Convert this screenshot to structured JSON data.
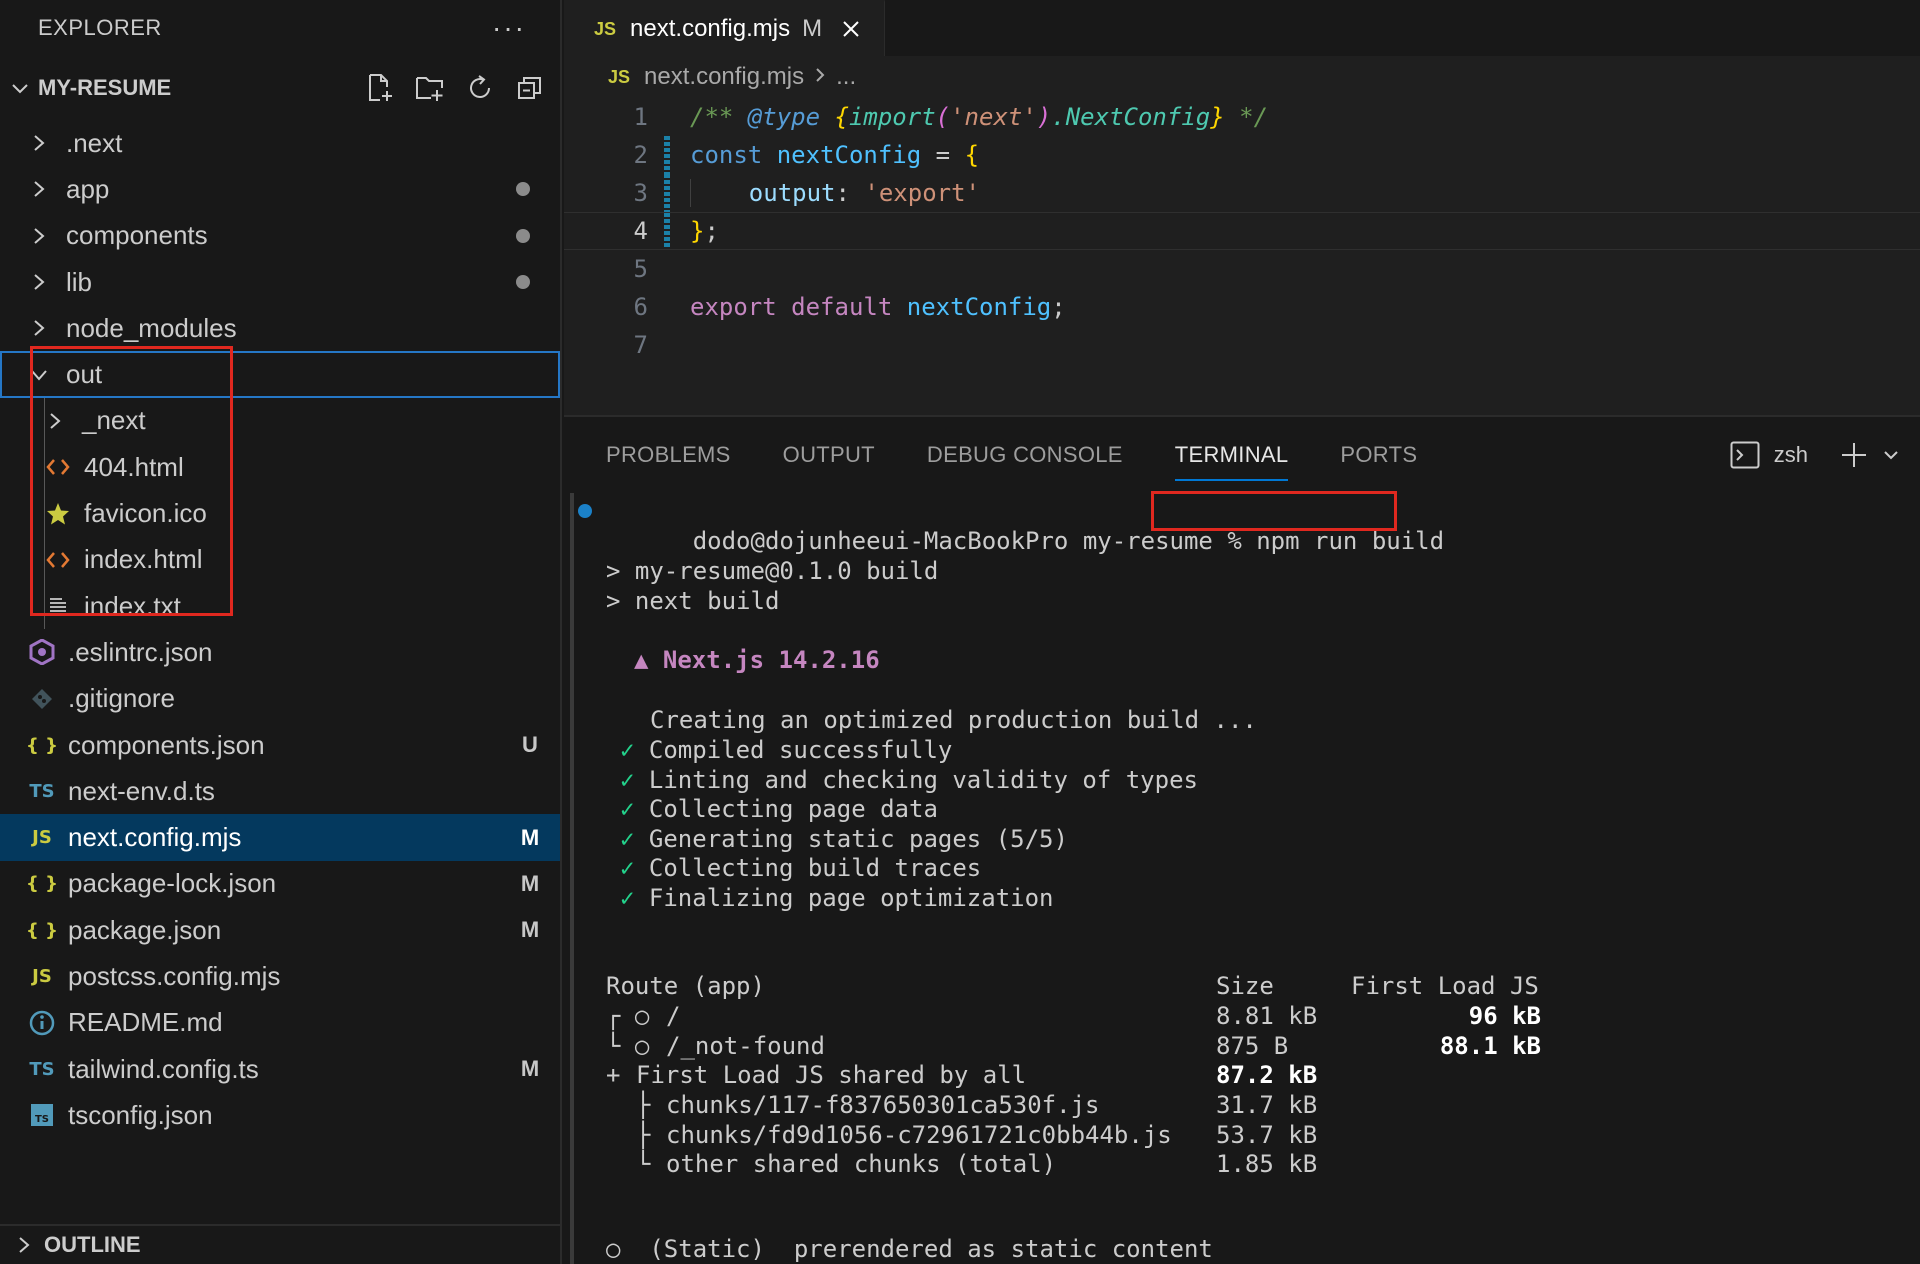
{
  "explorer": {
    "title": "EXPLORER",
    "more": "···",
    "project": "MY-RESUME",
    "outline": "OUTLINE",
    "tree": [
      {
        "label": ".next",
        "type": "folder",
        "status": ""
      },
      {
        "label": "app",
        "type": "folder",
        "status": "dot"
      },
      {
        "label": "components",
        "type": "folder",
        "status": "dot"
      },
      {
        "label": "lib",
        "type": "folder",
        "status": "dot"
      },
      {
        "label": "node_modules",
        "type": "folder",
        "status": ""
      },
      {
        "label": "out",
        "type": "folder-open",
        "status": ""
      },
      {
        "label": "_next",
        "type": "folder",
        "status": ""
      },
      {
        "label": "404.html",
        "type": "html",
        "status": ""
      },
      {
        "label": "favicon.ico",
        "type": "ico",
        "status": ""
      },
      {
        "label": "index.html",
        "type": "html",
        "status": ""
      },
      {
        "label": "index.txt",
        "type": "txt",
        "status": ""
      },
      {
        "label": ".eslintrc.json",
        "type": "eslint",
        "status": ""
      },
      {
        "label": ".gitignore",
        "type": "git",
        "status": ""
      },
      {
        "label": "components.json",
        "type": "json",
        "status": "U"
      },
      {
        "label": "next-env.d.ts",
        "type": "ts",
        "status": ""
      },
      {
        "label": "next.config.mjs",
        "type": "js",
        "status": "M"
      },
      {
        "label": "package-lock.json",
        "type": "json",
        "status": "M"
      },
      {
        "label": "package.json",
        "type": "json",
        "status": "M"
      },
      {
        "label": "postcss.config.mjs",
        "type": "js",
        "status": ""
      },
      {
        "label": "README.md",
        "type": "info",
        "status": ""
      },
      {
        "label": "tailwind.config.ts",
        "type": "ts",
        "status": "M"
      },
      {
        "label": "tsconfig.json",
        "type": "tsconfig",
        "status": ""
      }
    ],
    "icons": {
      "js": "JS",
      "ts": "TS",
      "json": "{ }"
    }
  },
  "editor": {
    "tab": {
      "icon": "JS",
      "name": "next.config.mjs",
      "modified": "M"
    },
    "breadcrumb": {
      "icon": "JS",
      "file": "next.config.mjs",
      "rest": "..."
    },
    "lines": [
      "1",
      "2",
      "3",
      "4",
      "5",
      "6",
      "7"
    ],
    "code": {
      "l1": {
        "open": "/** ",
        "tag": "@type",
        "sp": " ",
        "b1": "{",
        "fn": "import",
        "p1": "(",
        "str": "'next'",
        "p2": ")",
        "dot": ".",
        "type": "NextConfig",
        "b2": "}",
        "close": " */"
      },
      "l2": {
        "kw": "const",
        "var": "nextConfig",
        "eq": " = ",
        "brace": "{"
      },
      "l3": {
        "prop": "output",
        "colon": ": ",
        "str": "'export'"
      },
      "l4": {
        "brace": "}",
        "semi": ";"
      },
      "l6": {
        "kw1": "export",
        "kw2": "default",
        "var": "nextConfig",
        "semi": ";"
      }
    }
  },
  "panel": {
    "tabs": [
      "PROBLEMS",
      "OUTPUT",
      "DEBUG CONSOLE",
      "TERMINAL",
      "PORTS"
    ],
    "active_tab": "TERMINAL",
    "shell": "zsh",
    "terminal": {
      "prompt": "dodo@dojunheeui-MacBookPro my-resume",
      "command": "% npm run build",
      "l1": "> my-resume@0.1.0 build",
      "l2": "> next build",
      "nextjs": "▲ Next.js 14.2.16",
      "creating": "Creating an optimized production build ...",
      "checks": [
        "Compiled successfully",
        "Linting and checking validity of types",
        "Collecting page data",
        "Generating static pages (5/5)",
        "Collecting build traces",
        "Finalizing page optimization"
      ],
      "check_mark": "✓",
      "table": {
        "route_header": "Route (app)",
        "size_header": "Size",
        "first_load_header": "First Load JS",
        "rows": [
          {
            "prefix": "┌ ○",
            "route": "/",
            "size": "8.81 kB",
            "first": "96 kB"
          },
          {
            "prefix": "└ ○",
            "route": "/_not-found",
            "size": "875 B",
            "first": "88.1 kB"
          }
        ],
        "shared": {
          "prefix": "+",
          "label": "First Load JS shared by all",
          "size": "87.2 kB"
        },
        "chunks": [
          {
            "prefix": "├",
            "name": "chunks/117-f837650301ca530f.js",
            "size": "31.7 kB"
          },
          {
            "prefix": "├",
            "name": "chunks/fd9d1056-c72961721c0bb44b.js",
            "size": "53.7 kB"
          },
          {
            "prefix": "└",
            "name": "other shared chunks (total)",
            "size": "1.85 kB"
          }
        ]
      },
      "legend": "○  (Static)  prerendered as static content"
    }
  },
  "colors": {
    "accent": "#0078d4",
    "highlight": "#e0281f",
    "selected": "#04395e"
  }
}
